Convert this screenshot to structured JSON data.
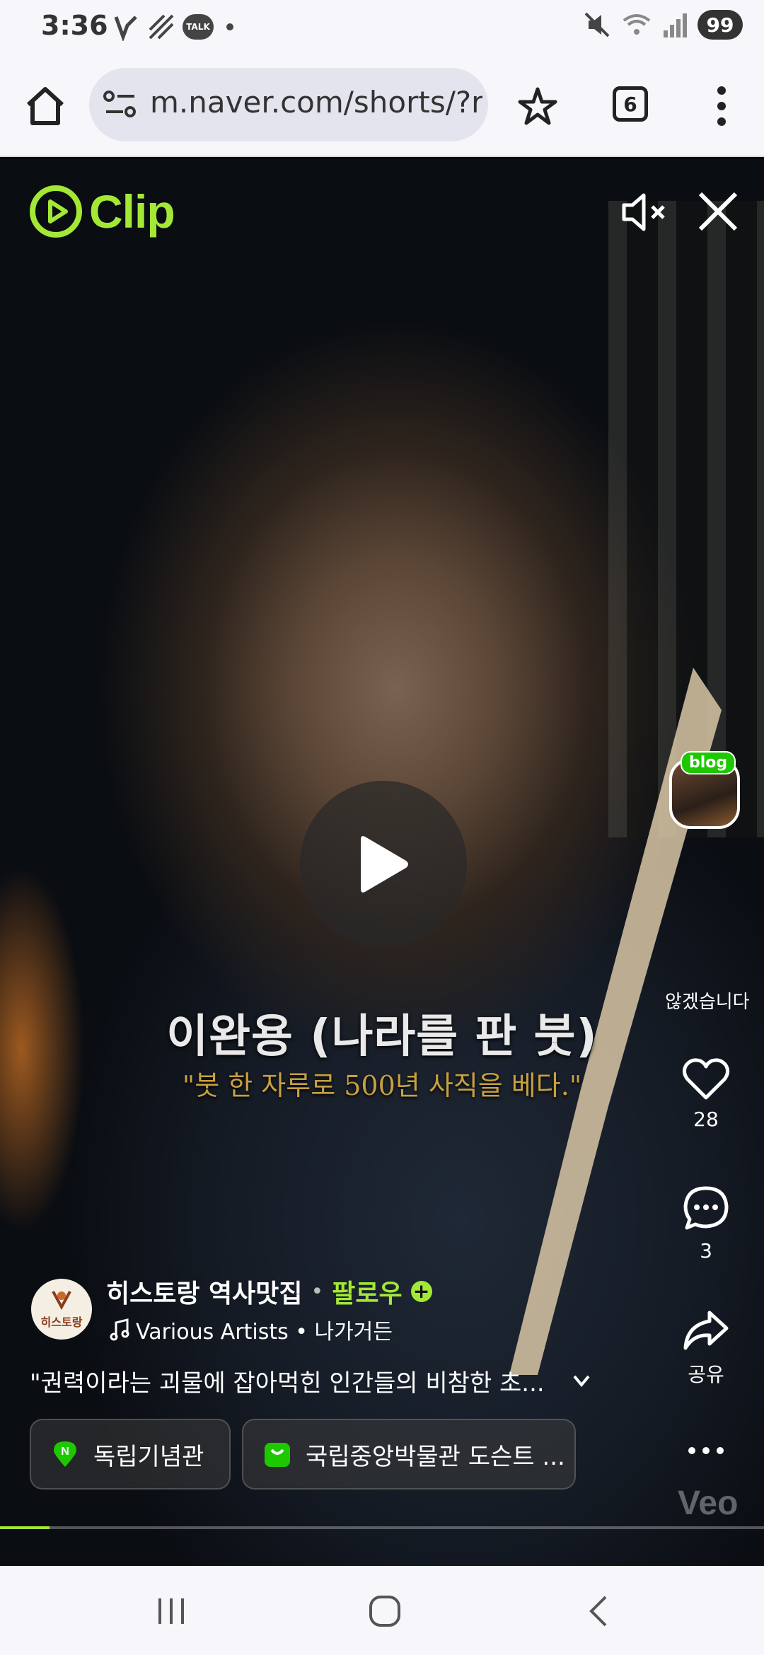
{
  "status_bar": {
    "time": "3:36",
    "battery": "99",
    "talk_badge": "TALK"
  },
  "browser": {
    "url": "m.naver.com/shorts/?r",
    "tab_count": "6"
  },
  "player": {
    "logo_text": "Clip",
    "brand_color": "#a4e836",
    "subtitle_title": "이완용 (나라를 판 붓)",
    "subtitle_quote": "\"붓 한 자루로 500년 사직을 베다.\"",
    "watermark": "Veo",
    "progress": 0.065
  },
  "rail": {
    "blog_badge": "blog",
    "blog_label": "않겠습니다",
    "likes": "28",
    "comments": "3",
    "share_label": "공유"
  },
  "info": {
    "avatar_text": "히스토랑",
    "author": "히스토랑 역사맛집",
    "separator": "•",
    "follow": "팔로우",
    "music": "Various Artists • 나가거든",
    "description": "\"권력이라는 괴물에 잡아먹힌 인간들의 비참한 초...",
    "tags": [
      {
        "label": "독립기념관",
        "icon": "naver-place-pin-icon"
      },
      {
        "label": "국립중앙박물관 도슨트 ...",
        "icon": "naver-shopping-bag-icon"
      }
    ]
  }
}
